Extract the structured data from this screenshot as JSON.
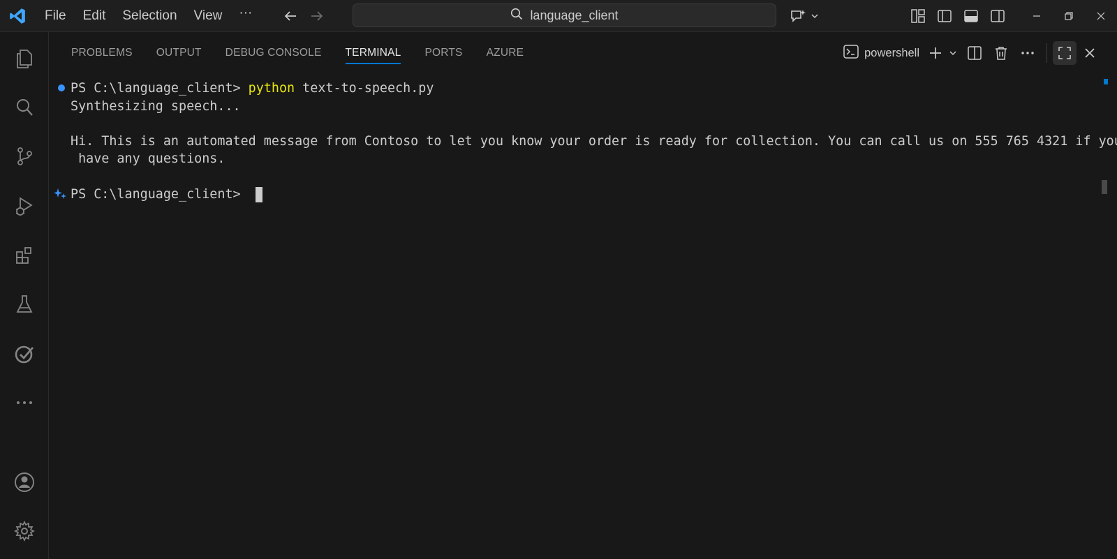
{
  "titlebar": {
    "menu": [
      "File",
      "Edit",
      "Selection",
      "View"
    ],
    "more": "···",
    "search_text": "language_client"
  },
  "panel": {
    "tabs": [
      "PROBLEMS",
      "OUTPUT",
      "DEBUG CONSOLE",
      "TERMINAL",
      "PORTS",
      "AZURE"
    ],
    "active_tab": "TERMINAL",
    "shell_name": "powershell"
  },
  "terminal": {
    "prompt1": "PS C:\\language_client> ",
    "cmd_program": "python",
    "cmd_args": " text-to-speech.py",
    "output1": "Synthesizing speech...",
    "output2": "Hi. This is an automated message from Contoso to let you know your order is ready for collection. You can call us on 555 765 4321 if you",
    "output3": " have any questions.",
    "prompt2": "PS C:\\language_client> "
  },
  "colors": {
    "accent": "#0078d4",
    "python_keyword": "#e5e510",
    "decoration_dot": "#3794ff"
  },
  "icons": {
    "activity": [
      "explorer-icon",
      "search-icon",
      "source-control-icon",
      "run-debug-icon",
      "extensions-icon",
      "testing-icon",
      "checklist-icon",
      "more-icon",
      "account-icon",
      "settings-icon"
    ]
  }
}
